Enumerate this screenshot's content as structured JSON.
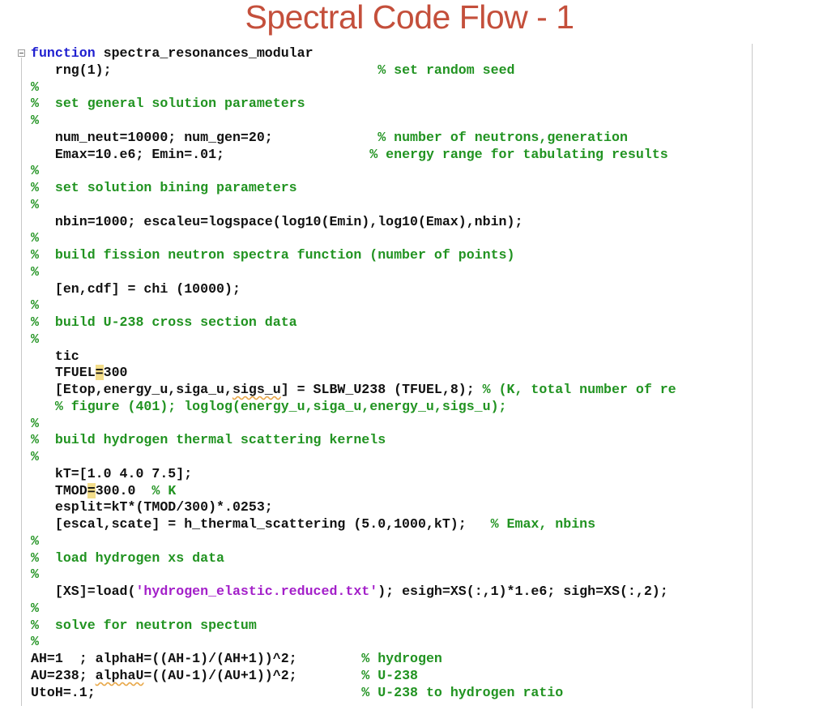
{
  "slide": {
    "title": "Spectral Code Flow - 1"
  },
  "code_lines": [
    [
      {
        "t": "function",
        "c": "kw"
      },
      {
        "t": " spectra_resonances_modular",
        "c": "pl"
      }
    ],
    [
      {
        "t": "   rng(1);                                 ",
        "c": "pl"
      },
      {
        "t": "% set random seed",
        "c": "cm"
      }
    ],
    [
      {
        "t": "%",
        "c": "cm"
      }
    ],
    [
      {
        "t": "%  set general solution parameters",
        "c": "cm"
      }
    ],
    [
      {
        "t": "%",
        "c": "cm"
      }
    ],
    [
      {
        "t": "   num_neut=10000; num_gen=20;             ",
        "c": "pl"
      },
      {
        "t": "% number of neutrons,generation",
        "c": "cm"
      }
    ],
    [
      {
        "t": "   Emax=10.e6; Emin=.01;                  ",
        "c": "pl"
      },
      {
        "t": "% energy range for tabulating results",
        "c": "cm"
      }
    ],
    [
      {
        "t": "%",
        "c": "cm"
      }
    ],
    [
      {
        "t": "%  set solution bining parameters",
        "c": "cm"
      }
    ],
    [
      {
        "t": "%",
        "c": "cm"
      }
    ],
    [
      {
        "t": "   nbin=1000; escaleu=logspace(log10(Emin),log10(Emax),nbin);",
        "c": "pl"
      }
    ],
    [
      {
        "t": "%",
        "c": "cm"
      }
    ],
    [
      {
        "t": "%  build fission neutron spectra function (number of points)",
        "c": "cm"
      }
    ],
    [
      {
        "t": "%",
        "c": "cm"
      }
    ],
    [
      {
        "t": "   [en,cdf] = chi (10000);",
        "c": "pl"
      }
    ],
    [
      {
        "t": "%",
        "c": "cm"
      }
    ],
    [
      {
        "t": "%  build U-238 cross section data",
        "c": "cm"
      }
    ],
    [
      {
        "t": "%",
        "c": "cm"
      }
    ],
    [
      {
        "t": "   tic",
        "c": "pl"
      }
    ],
    [
      {
        "t": "   TFUEL",
        "c": "pl"
      },
      {
        "t": "=",
        "c": "mk"
      },
      {
        "t": "300",
        "c": "pl"
      }
    ],
    [
      {
        "t": "   [Etop,energy_u,siga_u,",
        "c": "pl"
      },
      {
        "t": "sigs_u",
        "c": "w"
      },
      {
        "t": "] = SLBW_U238 (TFUEL,8); ",
        "c": "pl"
      },
      {
        "t": "% (K, total number of re",
        "c": "cm"
      }
    ],
    [
      {
        "t": "   % figure (401); loglog(energy_u,siga_u,energy_u,sigs_u);",
        "c": "cm"
      }
    ],
    [
      {
        "t": "%",
        "c": "cm"
      }
    ],
    [
      {
        "t": "%  build hydrogen thermal scattering kernels",
        "c": "cm"
      }
    ],
    [
      {
        "t": "%",
        "c": "cm"
      }
    ],
    [
      {
        "t": "   kT=[1.0 4.0 7.5];",
        "c": "pl"
      }
    ],
    [
      {
        "t": "   TMOD",
        "c": "pl"
      },
      {
        "t": "=",
        "c": "mk"
      },
      {
        "t": "300.0  ",
        "c": "pl"
      },
      {
        "t": "% K",
        "c": "cm"
      }
    ],
    [
      {
        "t": "   esplit=kT*(TMOD/300)*.0253;",
        "c": "pl"
      }
    ],
    [
      {
        "t": "   [escal,scate] = h_thermal_scattering (5.0,1000,kT);   ",
        "c": "pl"
      },
      {
        "t": "% Emax, nbins",
        "c": "cm"
      }
    ],
    [
      {
        "t": "%",
        "c": "cm"
      }
    ],
    [
      {
        "t": "%  load hydrogen xs data",
        "c": "cm"
      }
    ],
    [
      {
        "t": "%",
        "c": "cm"
      }
    ],
    [
      {
        "t": "   [XS]=load(",
        "c": "pl"
      },
      {
        "t": "'hydrogen_elastic.reduced.txt'",
        "c": "st"
      },
      {
        "t": "); esigh=XS(:,1)*1.e6; sigh=XS(:,2);",
        "c": "pl"
      }
    ],
    [
      {
        "t": "%",
        "c": "cm"
      }
    ],
    [
      {
        "t": "%  solve for neutron spectum",
        "c": "cm"
      }
    ],
    [
      {
        "t": "%",
        "c": "cm"
      }
    ],
    [
      {
        "t": "AH=1  ; alphaH=((AH-1)/(AH+1))^2;        ",
        "c": "pl"
      },
      {
        "t": "% hydrogen",
        "c": "cm"
      }
    ],
    [
      {
        "t": "AU=238; ",
        "c": "pl"
      },
      {
        "t": "alphaU",
        "c": "w"
      },
      {
        "t": "=((AU-1)/(AU+1))^2;        ",
        "c": "pl"
      },
      {
        "t": "% U-238",
        "c": "cm"
      }
    ],
    [
      {
        "t": "UtoH=.1;                                 ",
        "c": "pl"
      },
      {
        "t": "% U-238 to hydrogen ratio",
        "c": "cm"
      }
    ]
  ]
}
